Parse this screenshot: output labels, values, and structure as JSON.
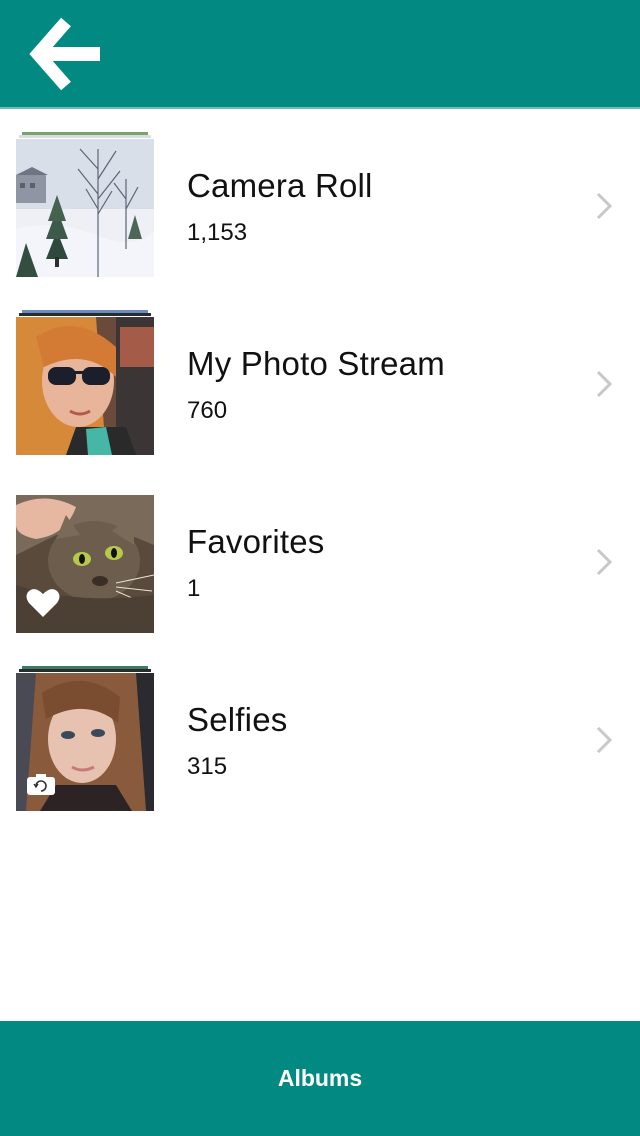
{
  "header": {
    "back_icon": "back-arrow-icon",
    "background_color": "#028a82"
  },
  "albums": [
    {
      "title": "Camera Roll",
      "count": "1,153",
      "thumbnail": "snowy-trees-photo",
      "badge": ""
    },
    {
      "title": "My Photo Stream",
      "count": "760",
      "thumbnail": "selfie-sunglasses-photo",
      "badge": ""
    },
    {
      "title": "Favorites",
      "count": "1",
      "thumbnail": "cat-photo",
      "badge": "heart-icon"
    },
    {
      "title": "Selfies",
      "count": "315",
      "thumbnail": "selfie-photo",
      "badge": "front-camera-icon"
    }
  ],
  "tab_bar": {
    "label": "Albums",
    "background_color": "#028a82"
  },
  "colors": {
    "accent": "#028a82",
    "chevron": "#c7c7cc",
    "text": "#111111"
  }
}
